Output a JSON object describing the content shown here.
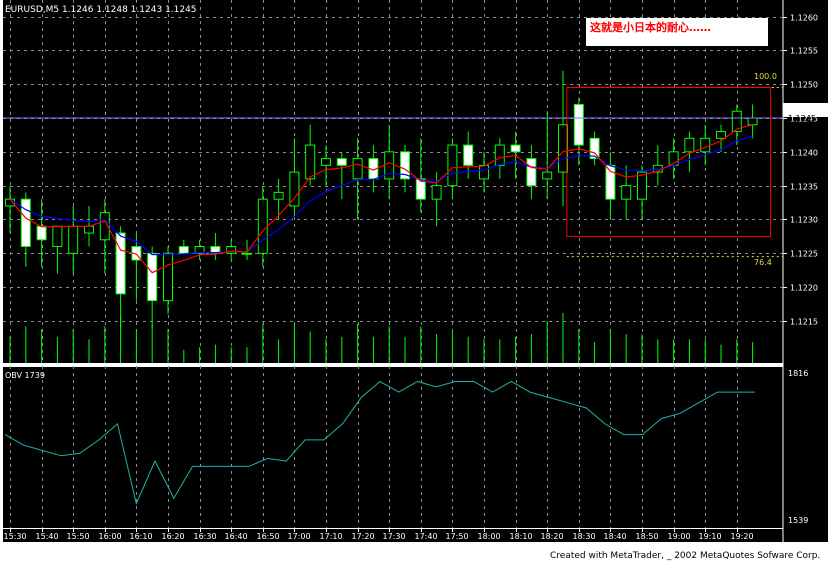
{
  "header": {
    "symbol_line": "EURUSD,M5  1.1246 1.1248 1.1243 1.1245"
  },
  "annotation": {
    "text": "这就是小日本的耐心……",
    "text_color": "#ff0000"
  },
  "fib": {
    "level_top_label": "100.0",
    "level_bottom_label": "76.4"
  },
  "obv": {
    "label": "OBV   1739",
    "max_label": "1816",
    "min_label": "1539"
  },
  "footer": {
    "credit": "Created with MetaTrader, _ 2002 MetaQuotes Sofware Corp."
  },
  "colors": {
    "background": "#000000",
    "grid": "#8c8c8c",
    "candle": "#00ff00",
    "bull_body": "#000000",
    "bear_body": "#ffffff",
    "ma_fast": "#ff0000",
    "ma_slow": "#0000ff",
    "obv_line": "#20b2aa",
    "current_price_line": "#8080ff",
    "fib_levels": "#e0e040",
    "box": "#ff0000",
    "axis_text": "#ffffff"
  },
  "chart_data": [
    {
      "type": "candlestick",
      "price_axis": {
        "ticks": [
          "1.1260",
          "1.1255",
          "1.1250",
          "1.1245",
          "1.1240",
          "1.1235",
          "1.1230",
          "1.1225",
          "1.1220",
          "1.1215"
        ],
        "range": [
          1.1211,
          1.1262
        ],
        "current_price": "1.1245"
      },
      "time_axis": {
        "ticks": [
          "15:30",
          "15:40",
          "15:50",
          "16:00",
          "16:10",
          "16:20",
          "16:30",
          "16:40",
          "16:50",
          "17:00",
          "17:10",
          "17:20",
          "17:30",
          "17:40",
          "17:50",
          "18:00",
          "18:10",
          "18:20",
          "18:30",
          "18:40",
          "18:50",
          "19:00",
          "19:10",
          "19:20"
        ],
        "start_time": "15:30",
        "bar_minutes": 5
      },
      "candles": [
        {
          "t": "15:30",
          "o": 1.1232,
          "h": 1.1235,
          "l": 1.1228,
          "c": 1.1233
        },
        {
          "t": "15:35",
          "o": 1.1233,
          "h": 1.1234,
          "l": 1.1223,
          "c": 1.1226
        },
        {
          "t": "15:40",
          "o": 1.1229,
          "h": 1.1233,
          "l": 1.1223,
          "c": 1.1227
        },
        {
          "t": "15:45",
          "o": 1.1226,
          "h": 1.1229,
          "l": 1.1222,
          "c": 1.1229
        },
        {
          "t": "15:50",
          "o": 1.1225,
          "h": 1.1232,
          "l": 1.1222,
          "c": 1.1229
        },
        {
          "t": "15:55",
          "o": 1.1228,
          "h": 1.1232,
          "l": 1.1226,
          "c": 1.1229
        },
        {
          "t": "16:00",
          "o": 1.1227,
          "h": 1.1233,
          "l": 1.1222,
          "c": 1.1231
        },
        {
          "t": "16:05",
          "o": 1.1228,
          "h": 1.1229,
          "l": 1.1214,
          "c": 1.1219
        },
        {
          "t": "16:10",
          "o": 1.1226,
          "h": 1.1228,
          "l": 1.1218,
          "c": 1.1224
        },
        {
          "t": "16:15",
          "o": 1.1225,
          "h": 1.1226,
          "l": 1.1214,
          "c": 1.1218
        },
        {
          "t": "16:20",
          "o": 1.1218,
          "h": 1.1226,
          "l": 1.1216,
          "c": 1.1225
        },
        {
          "t": "16:25",
          "o": 1.1226,
          "h": 1.1227,
          "l": 1.1225,
          "c": 1.1225
        },
        {
          "t": "16:30",
          "o": 1.1225,
          "h": 1.1227,
          "l": 1.1224,
          "c": 1.1226
        },
        {
          "t": "16:35",
          "o": 1.1226,
          "h": 1.1228,
          "l": 1.1224,
          "c": 1.1225
        },
        {
          "t": "16:40",
          "o": 1.1225,
          "h": 1.1227,
          "l": 1.1224,
          "c": 1.1226
        },
        {
          "t": "16:45",
          "o": 1.1225,
          "h": 1.1227,
          "l": 1.1224,
          "c": 1.1225
        },
        {
          "t": "16:50",
          "o": 1.1225,
          "h": 1.1235,
          "l": 1.1223,
          "c": 1.1233
        },
        {
          "t": "16:55",
          "o": 1.1233,
          "h": 1.1236,
          "l": 1.123,
          "c": 1.1234
        },
        {
          "t": "17:00",
          "o": 1.1232,
          "h": 1.1242,
          "l": 1.123,
          "c": 1.1237
        },
        {
          "t": "17:05",
          "o": 1.1236,
          "h": 1.1244,
          "l": 1.1235,
          "c": 1.1241
        },
        {
          "t": "17:10",
          "o": 1.1238,
          "h": 1.1241,
          "l": 1.1235,
          "c": 1.1239
        },
        {
          "t": "17:15",
          "o": 1.1239,
          "h": 1.124,
          "l": 1.1233,
          "c": 1.1238
        },
        {
          "t": "17:20",
          "o": 1.1236,
          "h": 1.1242,
          "l": 1.123,
          "c": 1.1239
        },
        {
          "t": "17:25",
          "o": 1.1239,
          "h": 1.1241,
          "l": 1.1234,
          "c": 1.1236
        },
        {
          "t": "17:30",
          "o": 1.1236,
          "h": 1.1244,
          "l": 1.1233,
          "c": 1.124
        },
        {
          "t": "17:35",
          "o": 1.124,
          "h": 1.1241,
          "l": 1.1234,
          "c": 1.1236
        },
        {
          "t": "17:40",
          "o": 1.1236,
          "h": 1.1242,
          "l": 1.1231,
          "c": 1.1233
        },
        {
          "t": "17:45",
          "o": 1.1233,
          "h": 1.1237,
          "l": 1.1229,
          "c": 1.1235
        },
        {
          "t": "17:50",
          "o": 1.1235,
          "h": 1.1242,
          "l": 1.1233,
          "c": 1.1241
        },
        {
          "t": "17:55",
          "o": 1.1241,
          "h": 1.1243,
          "l": 1.1236,
          "c": 1.1238
        },
        {
          "t": "18:00",
          "o": 1.1236,
          "h": 1.124,
          "l": 1.1234,
          "c": 1.1238
        },
        {
          "t": "18:05",
          "o": 1.1238,
          "h": 1.1242,
          "l": 1.1236,
          "c": 1.1241
        },
        {
          "t": "18:10",
          "o": 1.1241,
          "h": 1.1243,
          "l": 1.1236,
          "c": 1.124
        },
        {
          "t": "18:15",
          "o": 1.1239,
          "h": 1.1241,
          "l": 1.1233,
          "c": 1.1235
        },
        {
          "t": "18:20",
          "o": 1.1236,
          "h": 1.1246,
          "l": 1.1233,
          "c": 1.1237
        },
        {
          "t": "18:25",
          "o": 1.1237,
          "h": 1.1252,
          "l": 1.1232,
          "c": 1.1244
        },
        {
          "t": "18:30",
          "o": 1.1247,
          "h": 1.1248,
          "l": 1.1238,
          "c": 1.1241
        },
        {
          "t": "18:35",
          "o": 1.1242,
          "h": 1.1243,
          "l": 1.1238,
          "c": 1.1239
        },
        {
          "t": "18:40",
          "o": 1.1238,
          "h": 1.124,
          "l": 1.123,
          "c": 1.1233
        },
        {
          "t": "18:45",
          "o": 1.1233,
          "h": 1.1238,
          "l": 1.123,
          "c": 1.1235
        },
        {
          "t": "18:50",
          "o": 1.1233,
          "h": 1.1238,
          "l": 1.123,
          "c": 1.1237
        },
        {
          "t": "18:55",
          "o": 1.1237,
          "h": 1.1241,
          "l": 1.1235,
          "c": 1.1238
        },
        {
          "t": "19:00",
          "o": 1.1238,
          "h": 1.1242,
          "l": 1.1236,
          "c": 1.124
        },
        {
          "t": "19:05",
          "o": 1.124,
          "h": 1.1243,
          "l": 1.1237,
          "c": 1.1242
        },
        {
          "t": "19:10",
          "o": 1.124,
          "h": 1.1244,
          "l": 1.1238,
          "c": 1.1242
        },
        {
          "t": "19:15",
          "o": 1.1242,
          "h": 1.1244,
          "l": 1.124,
          "c": 1.1243
        },
        {
          "t": "19:20",
          "o": 1.1243,
          "h": 1.1247,
          "l": 1.1241,
          "c": 1.1246
        },
        {
          "t": "19:25",
          "o": 1.1244,
          "h": 1.1247,
          "l": 1.1242,
          "c": 1.1245
        }
      ],
      "fib_levels": [
        1.12495,
        1.12245
      ],
      "highlight_box": {
        "time_from": "18:30",
        "time_to": "19:25",
        "price_high": 1.12495,
        "price_low": 1.12275
      }
    },
    {
      "type": "line",
      "name": "OBV",
      "ylim": [
        1539,
        1816
      ],
      "values": [
        1700,
        1680,
        1670,
        1660,
        1665,
        1690,
        1720,
        1570,
        1650,
        1580,
        1640,
        1640,
        1640,
        1640,
        1655,
        1650,
        1690,
        1690,
        1720,
        1770,
        1800,
        1780,
        1800,
        1790,
        1800,
        1800,
        1780,
        1800,
        1780,
        1770,
        1760,
        1750,
        1720,
        1700,
        1700,
        1730,
        1740,
        1760,
        1780,
        1780,
        1780
      ]
    }
  ]
}
